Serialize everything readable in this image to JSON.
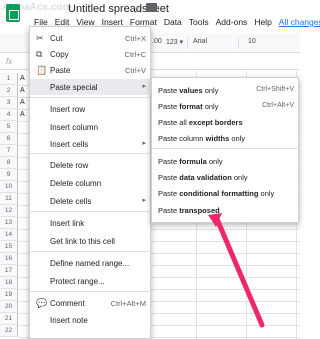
{
  "header": {
    "watermark": "AlphaAce.com",
    "doc_title": "Untitled spreadsheet",
    "star": "☆"
  },
  "menubar": {
    "items": [
      "File",
      "Edit",
      "View",
      "Insert",
      "Format",
      "Data",
      "Tools",
      "Add-ons",
      "Help"
    ],
    "changes_link": "All changes sa"
  },
  "toolbar": {
    "decimals": ".00",
    "format": "123 ▾",
    "font": "Arial",
    "font_size": "10"
  },
  "formula_bar": {
    "fx": "fx"
  },
  "rows": [
    "1",
    "2",
    "3",
    "4",
    "5",
    "6",
    "7",
    "8",
    "9",
    "10",
    "11",
    "12",
    "13",
    "14",
    "15",
    "16",
    "17",
    "18",
    "19",
    "20",
    "21",
    "22"
  ],
  "cells": [
    "A",
    "A",
    "A",
    "A"
  ],
  "context_menu": {
    "items": [
      {
        "icon": "✂",
        "label": "Cut",
        "shortcut": "Ctrl+X"
      },
      {
        "icon": "⧉",
        "label": "Copy",
        "shortcut": "Ctrl+C"
      },
      {
        "icon": "📋",
        "label": "Paste",
        "shortcut": "Ctrl+V"
      },
      {
        "label": "Paste special",
        "arrow": "▸"
      },
      {
        "label": "Insert row"
      },
      {
        "label": "Insert column"
      },
      {
        "label": "Insert cells",
        "arrow": "▸"
      },
      {
        "label": "Delete row"
      },
      {
        "label": "Delete column"
      },
      {
        "label": "Delete cells",
        "arrow": "▸"
      },
      {
        "label": "Insert link"
      },
      {
        "label": "Get link to this cell"
      },
      {
        "label": "Define named range..."
      },
      {
        "label": "Protect range..."
      },
      {
        "icon": "💬",
        "label": "Comment",
        "shortcut": "Ctrl+Alt+M"
      },
      {
        "label": "Insert note"
      }
    ]
  },
  "sub_menu": {
    "items": [
      {
        "pre": "Paste ",
        "bold": "values",
        "post": " only",
        "shortcut": "Ctrl+Shift+V"
      },
      {
        "pre": "Paste ",
        "bold": "format",
        "post": " only",
        "shortcut": "Ctrl+Alt+V"
      },
      {
        "pre": "Paste all ",
        "bold": "except borders",
        "post": ""
      },
      {
        "pre": "Paste column ",
        "bold": "widths",
        "post": " only"
      },
      {
        "pre": "Paste ",
        "bold": "formula",
        "post": " only"
      },
      {
        "pre": "Paste ",
        "bold": "data validation",
        "post": " only"
      },
      {
        "pre": "Paste ",
        "bold": "conditional formatting",
        "post": " only"
      },
      {
        "pre": "Paste ",
        "bold": "transposed",
        "post": ""
      }
    ]
  },
  "colors": {
    "accent_arrow": "#f0266b",
    "sheets_green": "#0f9d58",
    "link": "#1a73e8"
  }
}
